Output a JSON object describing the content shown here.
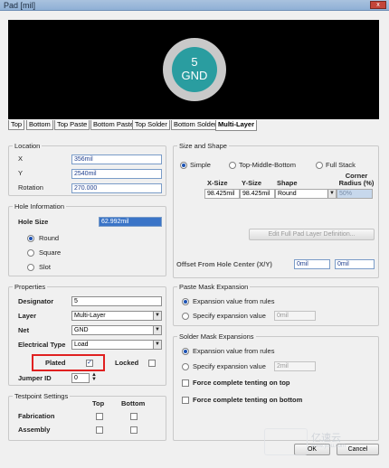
{
  "window": {
    "title": "Pad [mil]",
    "close": "x"
  },
  "preview": {
    "pad_label_line1": "5",
    "pad_label_line2": "GND"
  },
  "tabs": [
    "Top",
    "Bottom",
    "Top Paste",
    "Bottom Paste",
    "Top Solder",
    "Bottom Solder",
    "Multi-Layer"
  ],
  "location": {
    "title": "Location",
    "x_label": "X",
    "x_value": "356mil",
    "y_label": "Y",
    "y_value": "2540mil",
    "rotation_label": "Rotation",
    "rotation_value": "270.000"
  },
  "hole": {
    "title": "Hole Information",
    "size_label": "Hole Size",
    "size_value": "62.992mil",
    "options": [
      "Round",
      "Square",
      "Slot"
    ]
  },
  "properties": {
    "title": "Properties",
    "designator_label": "Designator",
    "designator_value": "5",
    "layer_label": "Layer",
    "layer_value": "Multi-Layer",
    "net_label": "Net",
    "net_value": "GND",
    "etype_label": "Electrical Type",
    "etype_value": "Load",
    "plated_label": "Plated",
    "locked_label": "Locked",
    "jumper_label": "Jumper ID",
    "jumper_value": "0"
  },
  "testpoint": {
    "title": "Testpoint Settings",
    "col_top": "Top",
    "col_bottom": "Bottom",
    "fab_label": "Fabrication",
    "asm_label": "Assembly"
  },
  "size_shape": {
    "title": "Size and Shape",
    "modes": [
      "Simple",
      "Top-Middle-Bottom",
      "Full Stack"
    ],
    "col_x": "X-Size",
    "col_y": "Y-Size",
    "col_shape": "Shape",
    "col_corner": "Corner Radius (%)",
    "x_value": "98.425mil",
    "y_value": "98.425mil",
    "shape_value": "Round",
    "corner_value": "50%",
    "edit_button": "Edit Full Pad Layer Definition...",
    "offset_label": "Offset From Hole Center (X/Y)",
    "offset_x": "0mil",
    "offset_y": "0mil"
  },
  "paste_mask": {
    "title": "Paste Mask Expansion",
    "opt_rules": "Expansion value from rules",
    "opt_specify": "Specify expansion value",
    "value": "0mil"
  },
  "solder_mask": {
    "title": "Solder Mask Expansions",
    "opt_rules": "Expansion value from rules",
    "opt_specify": "Specify expansion value",
    "value": "2mil",
    "tent_top": "Force complete tenting on top",
    "tent_bottom": "Force complete tenting on bottom"
  },
  "buttons": {
    "ok": "OK",
    "cancel": "Cancel"
  },
  "watermark": {
    "line1": "亿速云",
    "line2": "www.yisu.com"
  }
}
